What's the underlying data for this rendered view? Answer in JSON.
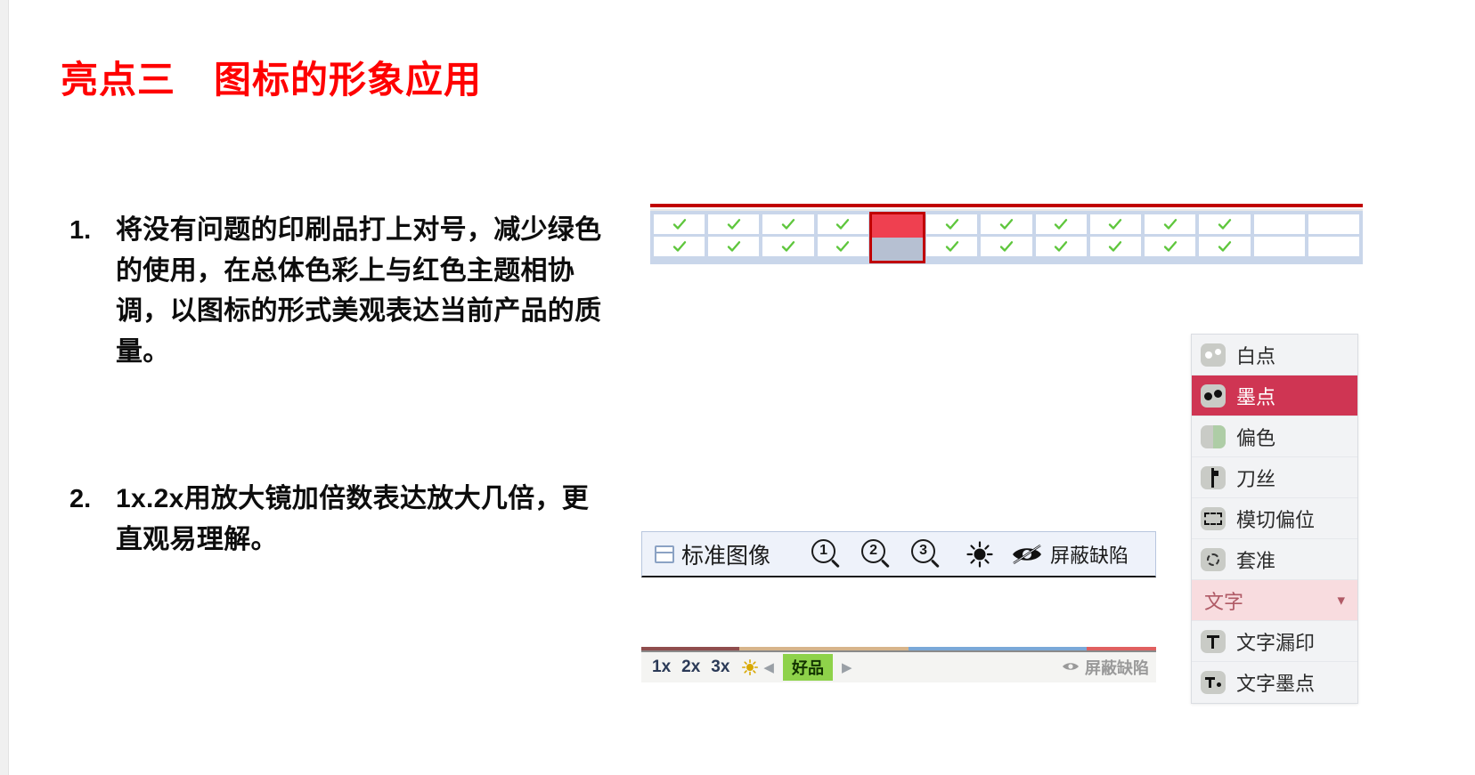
{
  "slide": {
    "title": "亮点三　图标的形象应用",
    "title_color": "#ff0000",
    "background": "#ffffff"
  },
  "bullets": [
    {
      "number": "1.",
      "text": "将没有问题的印刷品打上对号，减少绿色的使用，在总体色彩上与红色主题相协调，以图标的形式美观表达当前产品的质量。"
    },
    {
      "number": "2.",
      "text": "1x.2x用放大镜加倍数表达放大几倍，更直观易理解。"
    }
  ],
  "check_grid": {
    "accent_color": "#c00000",
    "grid_background": "#c9d6ea",
    "tick_color": "#5ec63c",
    "selected_top_color": "#ef4050",
    "selected_bottom_color": "#b6c0d2",
    "columns": [
      {
        "top": "check",
        "bottom": "check"
      },
      {
        "top": "check",
        "bottom": "check"
      },
      {
        "top": "check",
        "bottom": "check"
      },
      {
        "top": "check",
        "bottom": "check"
      },
      {
        "top": "selected-red",
        "bottom": "selected-gray"
      },
      {
        "top": "check",
        "bottom": "check"
      },
      {
        "top": "check",
        "bottom": "check"
      },
      {
        "top": "check",
        "bottom": "check"
      },
      {
        "top": "check",
        "bottom": "check"
      },
      {
        "top": "check",
        "bottom": "check"
      },
      {
        "top": "check",
        "bottom": "check"
      },
      {
        "top": "empty",
        "bottom": "empty"
      },
      {
        "top": "empty",
        "bottom": "empty"
      }
    ]
  },
  "toolbar": {
    "window_icon": "window-icon",
    "standard_image_label": "标准图像",
    "magnifiers": [
      "1",
      "2",
      "3"
    ],
    "brightness_icon": "sun-icon",
    "hide_icon": "eye-slash-icon",
    "mask_defect_label": "屏蔽缺陷"
  },
  "minibar": {
    "zoom_levels": [
      "1x",
      "2x",
      "3x"
    ],
    "brightness_icon": "sun-icon",
    "prev_arrow": "◀",
    "status_label": "好品",
    "status_color": "#8ed24a",
    "next_arrow": "▶",
    "mask_defect_label": "屏蔽缺陷"
  },
  "defect_panel": {
    "active_color": "#cf3553",
    "group_background": "#f8dcdf",
    "rows": [
      {
        "icon": "white-dot-icon",
        "label": "白点",
        "type": "item",
        "active": false
      },
      {
        "icon": "ink-dot-icon",
        "label": "墨点",
        "type": "item",
        "active": true
      },
      {
        "icon": "color-shift-icon",
        "label": "偏色",
        "type": "item",
        "active": false
      },
      {
        "icon": "knife-line-icon",
        "label": "刀丝",
        "type": "item",
        "active": false
      },
      {
        "icon": "die-cut-offset-icon",
        "label": "模切偏位",
        "type": "item",
        "active": false
      },
      {
        "icon": "registration-icon",
        "label": "套准",
        "type": "item",
        "active": false
      },
      {
        "icon": "chevron-down-icon",
        "label": "文字",
        "type": "group",
        "active": false
      },
      {
        "icon": "text-missing-print-icon",
        "label": "文字漏印",
        "type": "item",
        "active": false
      },
      {
        "icon": "text-ink-dot-icon",
        "label": "文字墨点",
        "type": "item",
        "active": false
      }
    ]
  }
}
